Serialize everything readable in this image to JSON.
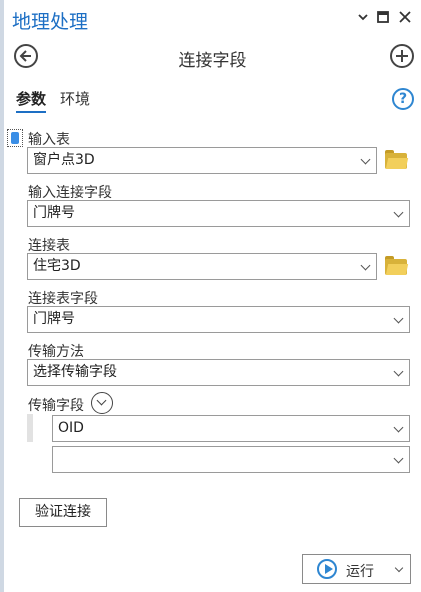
{
  "window": {
    "title": "地理处理",
    "menu_icon": "chevron-down-icon",
    "restore_icon": "maximize-icon",
    "close_icon": "close-icon"
  },
  "nav": {
    "title": "连接字段",
    "back_icon": "back-arrow-icon",
    "add_icon": "plus-circle-icon"
  },
  "tabs": [
    {
      "label": "参数",
      "active": true
    },
    {
      "label": "环境",
      "active": false
    }
  ],
  "help_label": "?",
  "params": {
    "input_table": {
      "label": "输入表",
      "value": "窗户点3D"
    },
    "input_join_field": {
      "label": "输入连接字段",
      "value": "门牌号"
    },
    "join_table": {
      "label": "连接表",
      "value": "住宅3D"
    },
    "join_table_field": {
      "label": "连接表字段",
      "value": "门牌号"
    },
    "transfer_method": {
      "label": "传输方法",
      "value": "选择传输字段"
    },
    "transfer_fields": {
      "label": "传输字段",
      "rows": [
        "OID",
        ""
      ]
    }
  },
  "validate_button": "验证连接",
  "run_button": "运行",
  "colors": {
    "accent": "#1d6fc4",
    "folder": "#d8b23a",
    "run_icon": "#2e86d1"
  }
}
